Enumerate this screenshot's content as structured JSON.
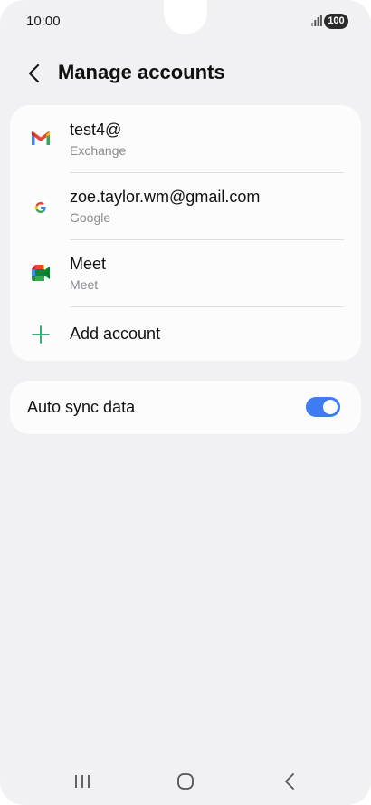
{
  "status_bar": {
    "time": "10:00",
    "battery": "100"
  },
  "header": {
    "title": "Manage accounts"
  },
  "accounts": [
    {
      "title": "test4@",
      "subtitle": "Exchange",
      "icon": "gmail-icon"
    },
    {
      "title": "zoe.taylor.wm@gmail.com",
      "subtitle": "Google",
      "icon": "google-icon"
    },
    {
      "title": "Meet",
      "subtitle": "Meet",
      "icon": "meet-icon"
    }
  ],
  "add_account": {
    "label": "Add account",
    "icon": "plus-icon"
  },
  "auto_sync": {
    "label": "Auto sync data",
    "enabled": true
  },
  "colors": {
    "accent": "#3e7cf1",
    "add_icon": "#2c9d6b",
    "background": "#f1f1f4"
  }
}
